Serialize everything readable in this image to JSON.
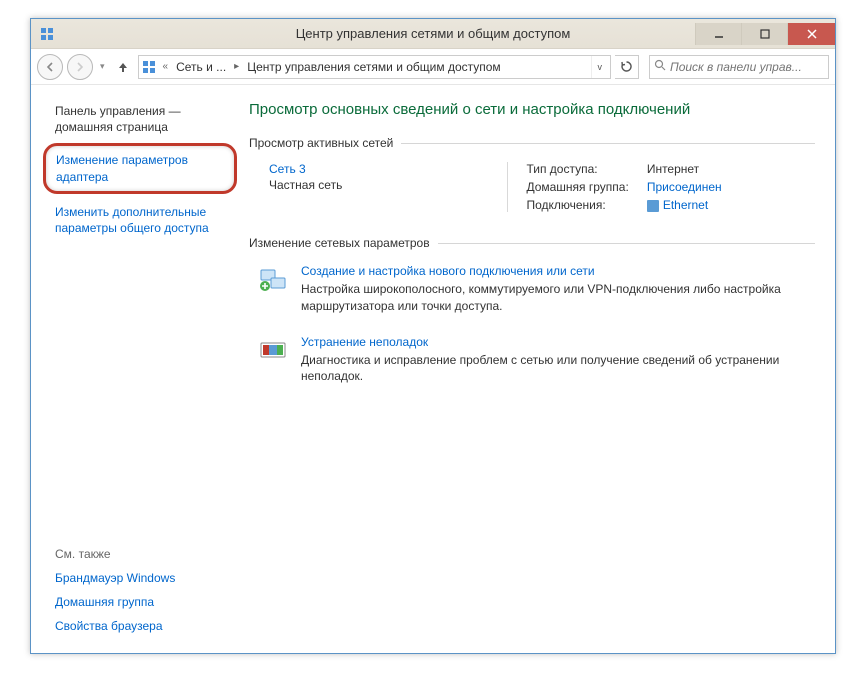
{
  "window": {
    "title": "Центр управления сетями и общим доступом"
  },
  "breadcrumb": {
    "seg1": "Сеть и ...",
    "seg2": "Центр управления сетями и общим доступом"
  },
  "search": {
    "placeholder": "Поиск в панели управ..."
  },
  "sidebar": {
    "home": "Панель управления — домашняя страница",
    "adapter": "Изменение параметров адаптера",
    "sharing": "Изменить дополнительные параметры общего доступа",
    "see_also_h": "См. также",
    "firewall": "Брандмауэр Windows",
    "homegroup": "Домашняя группа",
    "browser": "Свойства браузера"
  },
  "content": {
    "heading": "Просмотр основных сведений о сети и настройка подключений",
    "active_h": "Просмотр активных сетей",
    "network": {
      "name": "Сеть 3",
      "type": "Частная сеть",
      "access_label": "Тип доступа:",
      "access_val": "Интернет",
      "hg_label": "Домашняя группа:",
      "hg_val": "Присоединен",
      "conn_label": "Подключения:",
      "conn_val": "Ethernet"
    },
    "change_h": "Изменение сетевых параметров",
    "opt1": {
      "title": "Создание и настройка нового подключения или сети",
      "desc": "Настройка широкополосного, коммутируемого или VPN-подключения либо настройка маршрутизатора или точки доступа."
    },
    "opt2": {
      "title": "Устранение неполадок",
      "desc": "Диагностика и исправление проблем с сетью или получение сведений об устранении неполадок."
    }
  }
}
